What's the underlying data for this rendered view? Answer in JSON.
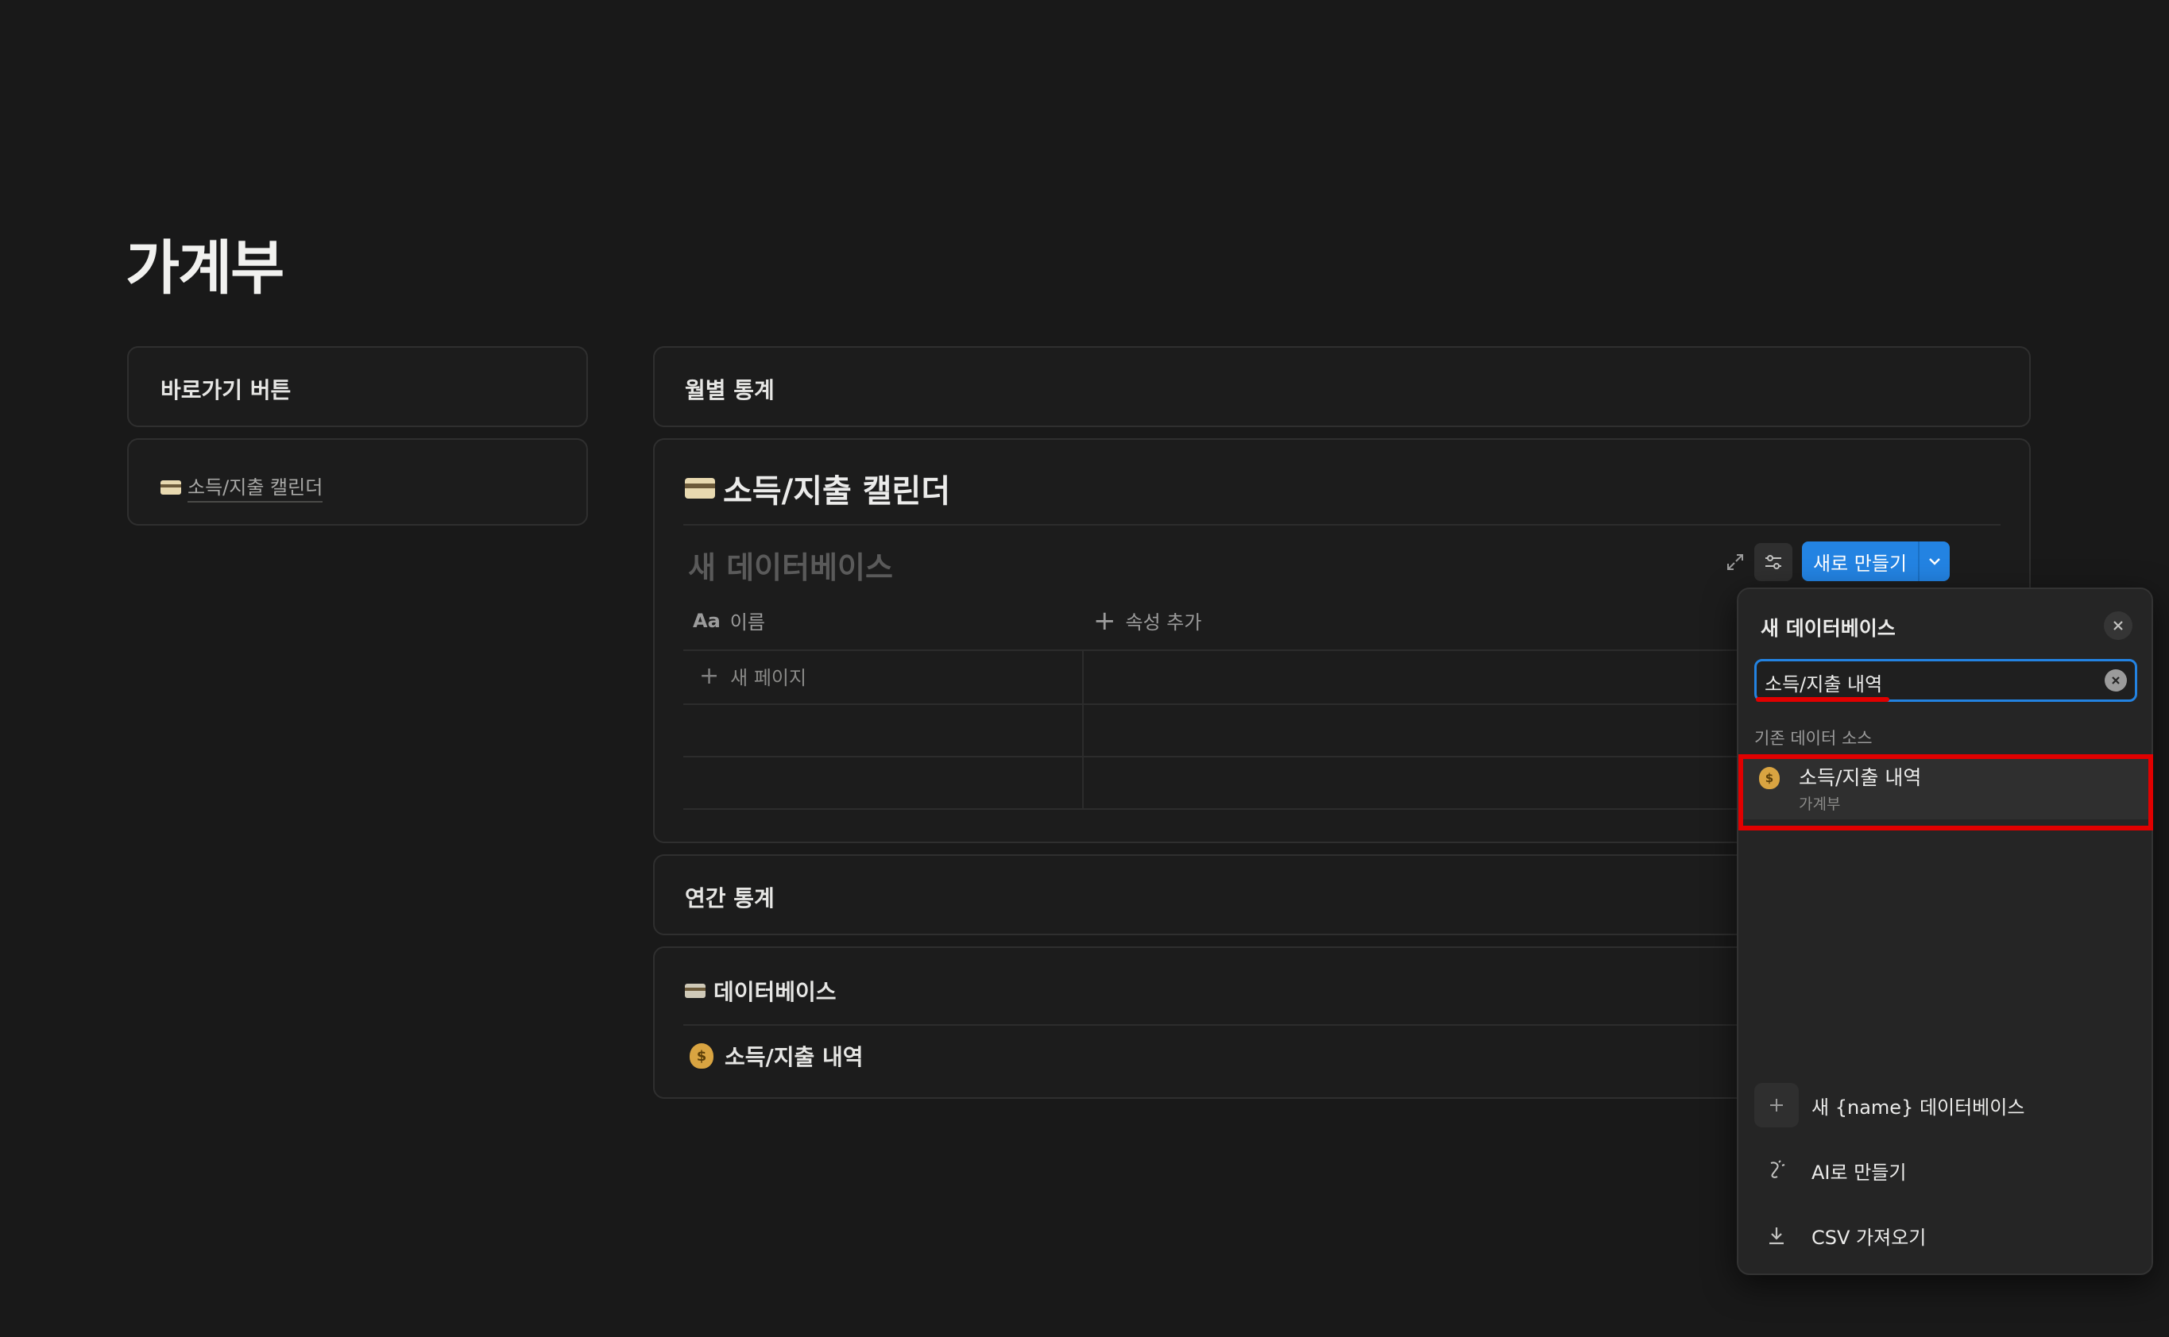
{
  "page": {
    "title": "가계부"
  },
  "left_panel": {
    "shortcut_title": "바로가기 버튼",
    "calendar_link": "소득/지출 캘린더"
  },
  "monthly": {
    "title": "월별 통계"
  },
  "calendar_block": {
    "title": "소득/지출 캘린더",
    "db_name_placeholder": "새 데이터베이스",
    "new_button_label": "새로 만들기",
    "columns": [
      {
        "icon": "Aa",
        "label": "이름"
      },
      {
        "icon": "plus-icon",
        "label": "속성 추가"
      }
    ],
    "new_page_label": "새 페이지"
  },
  "annual": {
    "title": "연간 통계"
  },
  "database_block": {
    "title": "데이터베이스",
    "item_label": "소득/지출 내역"
  },
  "popover": {
    "title": "새 데이터베이스",
    "search_value": "소득/지출 내역",
    "section_label": "기존 데이터 소스",
    "result": {
      "title": "소득/지출 내역",
      "subtitle": "가계부"
    },
    "actions": [
      {
        "icon": "plus-icon",
        "label": "새 {name} 데이터베이스"
      },
      {
        "icon": "ai-icon",
        "label": "AI로 만들기"
      },
      {
        "icon": "download-icon",
        "label": "CSV 가져오기"
      }
    ]
  },
  "colors": {
    "background": "#191919",
    "accent": "#2383e2",
    "highlight": "#e10000"
  }
}
